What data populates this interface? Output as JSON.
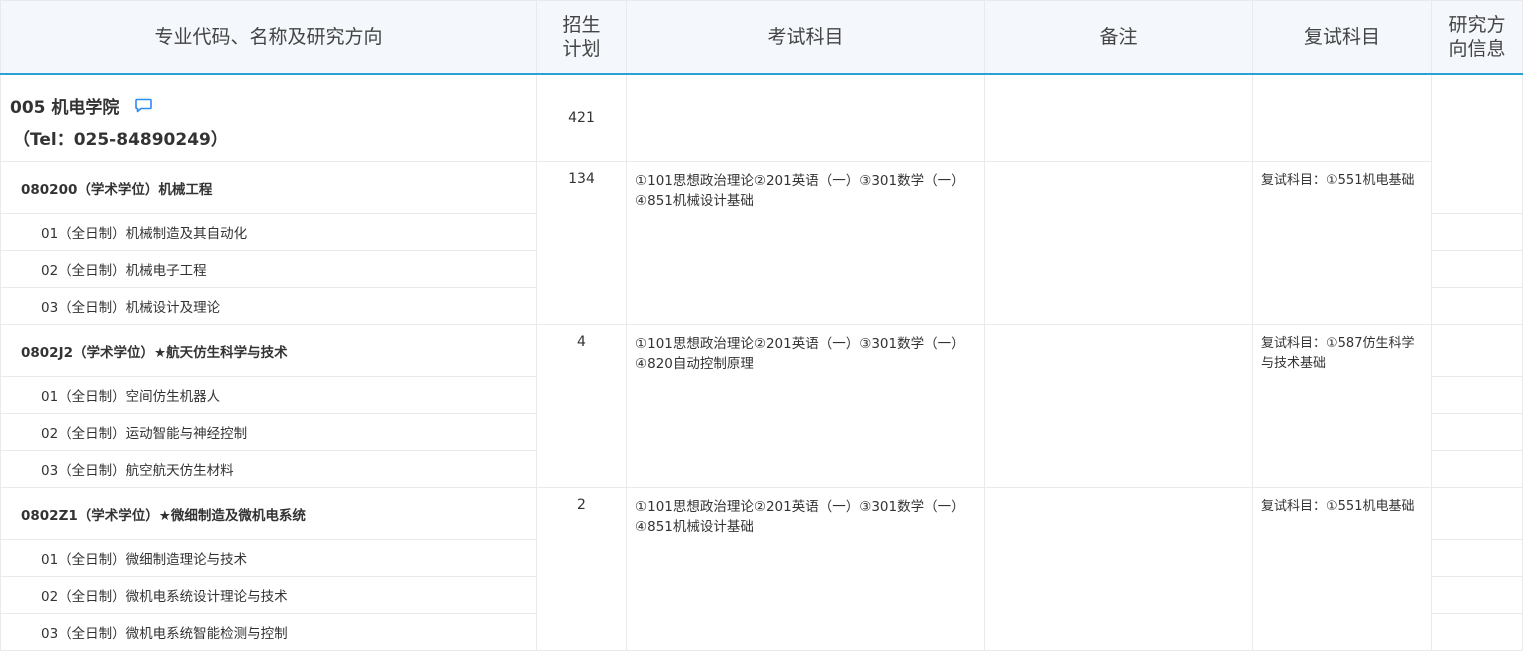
{
  "headers": {
    "name": "专业代码、名称及研究方向",
    "plan": "招生计划",
    "exam": "考试科目",
    "note": "备注",
    "retest": "复试科目",
    "info": "研究方向信息"
  },
  "college": {
    "title": "005 机电学院",
    "tel": "（Tel：025-84890249）",
    "plan": "421",
    "icon": "message-icon",
    "accent": "#2d8cf0"
  },
  "majors": [
    {
      "name": "080200（学术学位）机械工程",
      "plan": "134",
      "exam_line1": "①101思想政治理论②201英语（一）③301数学（一）",
      "exam_line2": "④851机械设计基础",
      "retest": "复试科目：①551机电基础",
      "directions": [
        "01（全日制）机械制造及其自动化",
        "02（全日制）机械电子工程",
        "03（全日制）机械设计及理论"
      ]
    },
    {
      "name": "0802J2（学术学位）★航天仿生科学与技术",
      "plan": "4",
      "exam_line1": "①101思想政治理论②201英语（一）③301数学（一）",
      "exam_line2": "④820自动控制原理",
      "retest": "复试科目：①587仿生科学与技术基础",
      "directions": [
        "01（全日制）空间仿生机器人",
        "02（全日制）运动智能与神经控制",
        "03（全日制）航空航天仿生材料"
      ]
    },
    {
      "name": "0802Z1（学术学位）★微细制造及微机电系统",
      "plan": "2",
      "exam_line1": "①101思想政治理论②201英语（一）③301数学（一）",
      "exam_line2": "④851机械设计基础",
      "retest": "复试科目：①551机电基础",
      "directions": [
        "01（全日制）微细制造理论与技术",
        "02（全日制）微机电系统设计理论与技术",
        "03（全日制）微机电系统智能检测与控制"
      ]
    }
  ]
}
